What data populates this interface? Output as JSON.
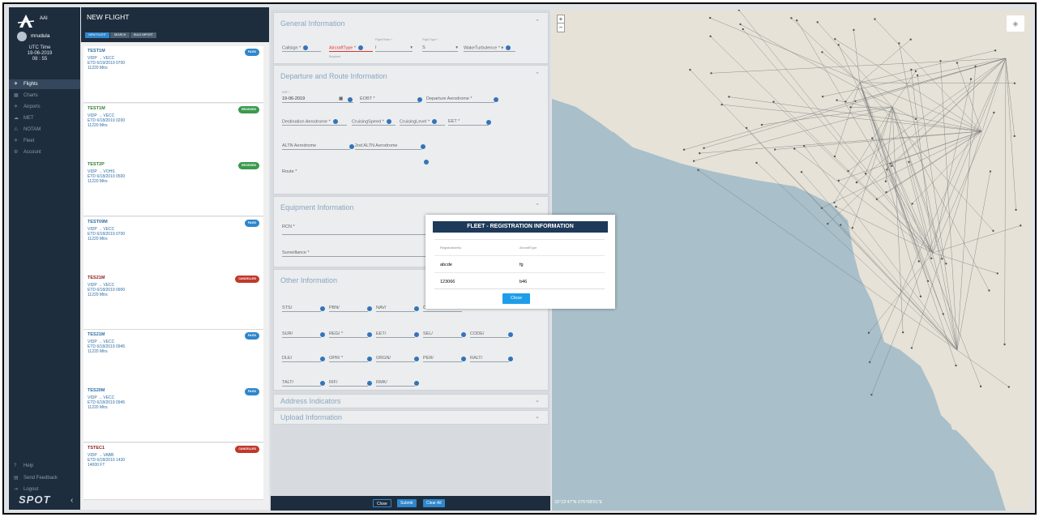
{
  "sidebar": {
    "logo_text": "AAI",
    "user": "mrudula",
    "utc_label": "UTC Time",
    "utc_date": "19-06-2019",
    "utc_time": "08 : 55",
    "items": [
      {
        "label": "Flights",
        "icon": "plane-icon"
      },
      {
        "label": "Charts",
        "icon": "chart-icon"
      },
      {
        "label": "Airports",
        "icon": "airport-icon"
      },
      {
        "label": "MET",
        "icon": "cloud-icon"
      },
      {
        "label": "NOTAM",
        "icon": "alert-icon"
      },
      {
        "label": "Fleet",
        "icon": "fleet-icon"
      },
      {
        "label": "Account",
        "icon": "gear-icon"
      }
    ],
    "bottom_items": [
      {
        "label": "Help",
        "icon": "help-icon"
      },
      {
        "label": "Send Feedback",
        "icon": "feedback-icon"
      },
      {
        "label": "Logout",
        "icon": "logout-icon"
      }
    ],
    "brand": "SPOT"
  },
  "flight_list": {
    "title": "NEW FLIGHT",
    "tabs": [
      "NEW FLIGHT",
      "SEARCH",
      "BULK IMPORT"
    ],
    "cards": [
      {
        "callsign": "TEST1M",
        "route": "VIDP → VECC",
        "etd": "ETD 6/19/2019 0700",
        "alt": "11220 Mtrs",
        "status": "FILED",
        "status_color": "#2f86cc"
      },
      {
        "callsign": "TEST1M",
        "route": "VIDP → VECC",
        "etd": "ETD 6/18/2019 0200",
        "alt": "11220 Mtrs",
        "status": "RECEIVED",
        "status_color": "#3a9a4c"
      },
      {
        "callsign": "TEST2P",
        "route": "VIDP → VOHS",
        "etd": "ETD 6/18/2019 0500",
        "alt": "11220 Mtrs",
        "status": "RECEIVED",
        "status_color": "#3a9a4c"
      },
      {
        "callsign": "TEST09M",
        "route": "VIDP → VECC",
        "etd": "ETD 6/18/2019 0700",
        "alt": "11220 Mtrs",
        "status": "FILED",
        "status_color": "#2f86cc"
      },
      {
        "callsign": "TES21M",
        "route": "VIDP → VECC",
        "etd": "ETD 6/18/2019 0900",
        "alt": "11220 Mtrs",
        "status": "CANCELLED",
        "status_color": "#c0392b"
      },
      {
        "callsign": "TES21M",
        "route": "VIDP → VECC",
        "etd": "ETD 6/18/2019 0945",
        "alt": "11220 Mtrs",
        "status": "FILED",
        "status_color": "#2f86cc"
      },
      {
        "callsign": "TES20M",
        "route": "VIDP → VECC",
        "etd": "ETD 6/18/2019 0945",
        "alt": "11220 Mtrs",
        "status": "FILED",
        "status_color": "#2f86cc"
      },
      {
        "callsign": "TSTEC1",
        "route": "VIDP → VABB",
        "etd": "ETD 6/18/2019 1430",
        "alt": "14000 FT",
        "status": "CANCELLED",
        "status_color": "#c0392b"
      }
    ]
  },
  "form": {
    "general": {
      "title": "General Information",
      "callsign": "Callsign *",
      "aircraft_type": "AircraftType *",
      "aircraft_required": "Required",
      "flight_rules_label": "Flight Rules *",
      "flight_rules_value": "I",
      "flight_type_label": "Flight Type *",
      "flight_type_value": "S",
      "wake": "WakeTurbulence *"
    },
    "departure": {
      "title": "Departure and Route Information",
      "dof_label": "DOF *",
      "dof_value": "19-06-2019",
      "eobt": "EOBT *",
      "dep_aero": "Departure Aerodrome *",
      "dest_aero": "Destination Aerodrome *",
      "cruise_speed": "CruisingSpeed *",
      "cruise_level": "CruisingLevel *",
      "eet": "EET *",
      "altn": "ALTN Aerodrome",
      "altn2": "2nd ALTN Aerodrome",
      "route": "Route *"
    },
    "equipment": {
      "title": "Equipment Information",
      "rcn": "RCN *",
      "surveillance": "Surveillance *"
    },
    "other": {
      "title": "Other Information",
      "rows": [
        [
          "STS/",
          "PBN/",
          "NAV/",
          "C"
        ],
        [
          "SUR/",
          "REG/ *",
          "EET/",
          "SEL/",
          "CODE/"
        ],
        [
          "DLE/",
          "OPR/ *",
          "ORGN/",
          "PER/",
          "RALT/"
        ],
        [
          "TALT/",
          "RIF/",
          "RMK/"
        ]
      ]
    },
    "address": {
      "title": "Address Indicators"
    },
    "upload": {
      "title": "Upload Information"
    },
    "buttons": {
      "close": "Close",
      "submit": "Submit",
      "clear": "Clear All"
    }
  },
  "map": {
    "coord": "32°22'47\"N 075°08'01\"E",
    "zoom_in": "+",
    "zoom_out": "−"
  },
  "modal": {
    "title": "FLEET - REGISTRATION INFORMATION",
    "columns": [
      "RegistrationNo",
      "AircraftType"
    ],
    "rows": [
      [
        "abcde",
        "fg"
      ],
      [
        "123066",
        "b46"
      ]
    ],
    "close_label": "Close"
  }
}
